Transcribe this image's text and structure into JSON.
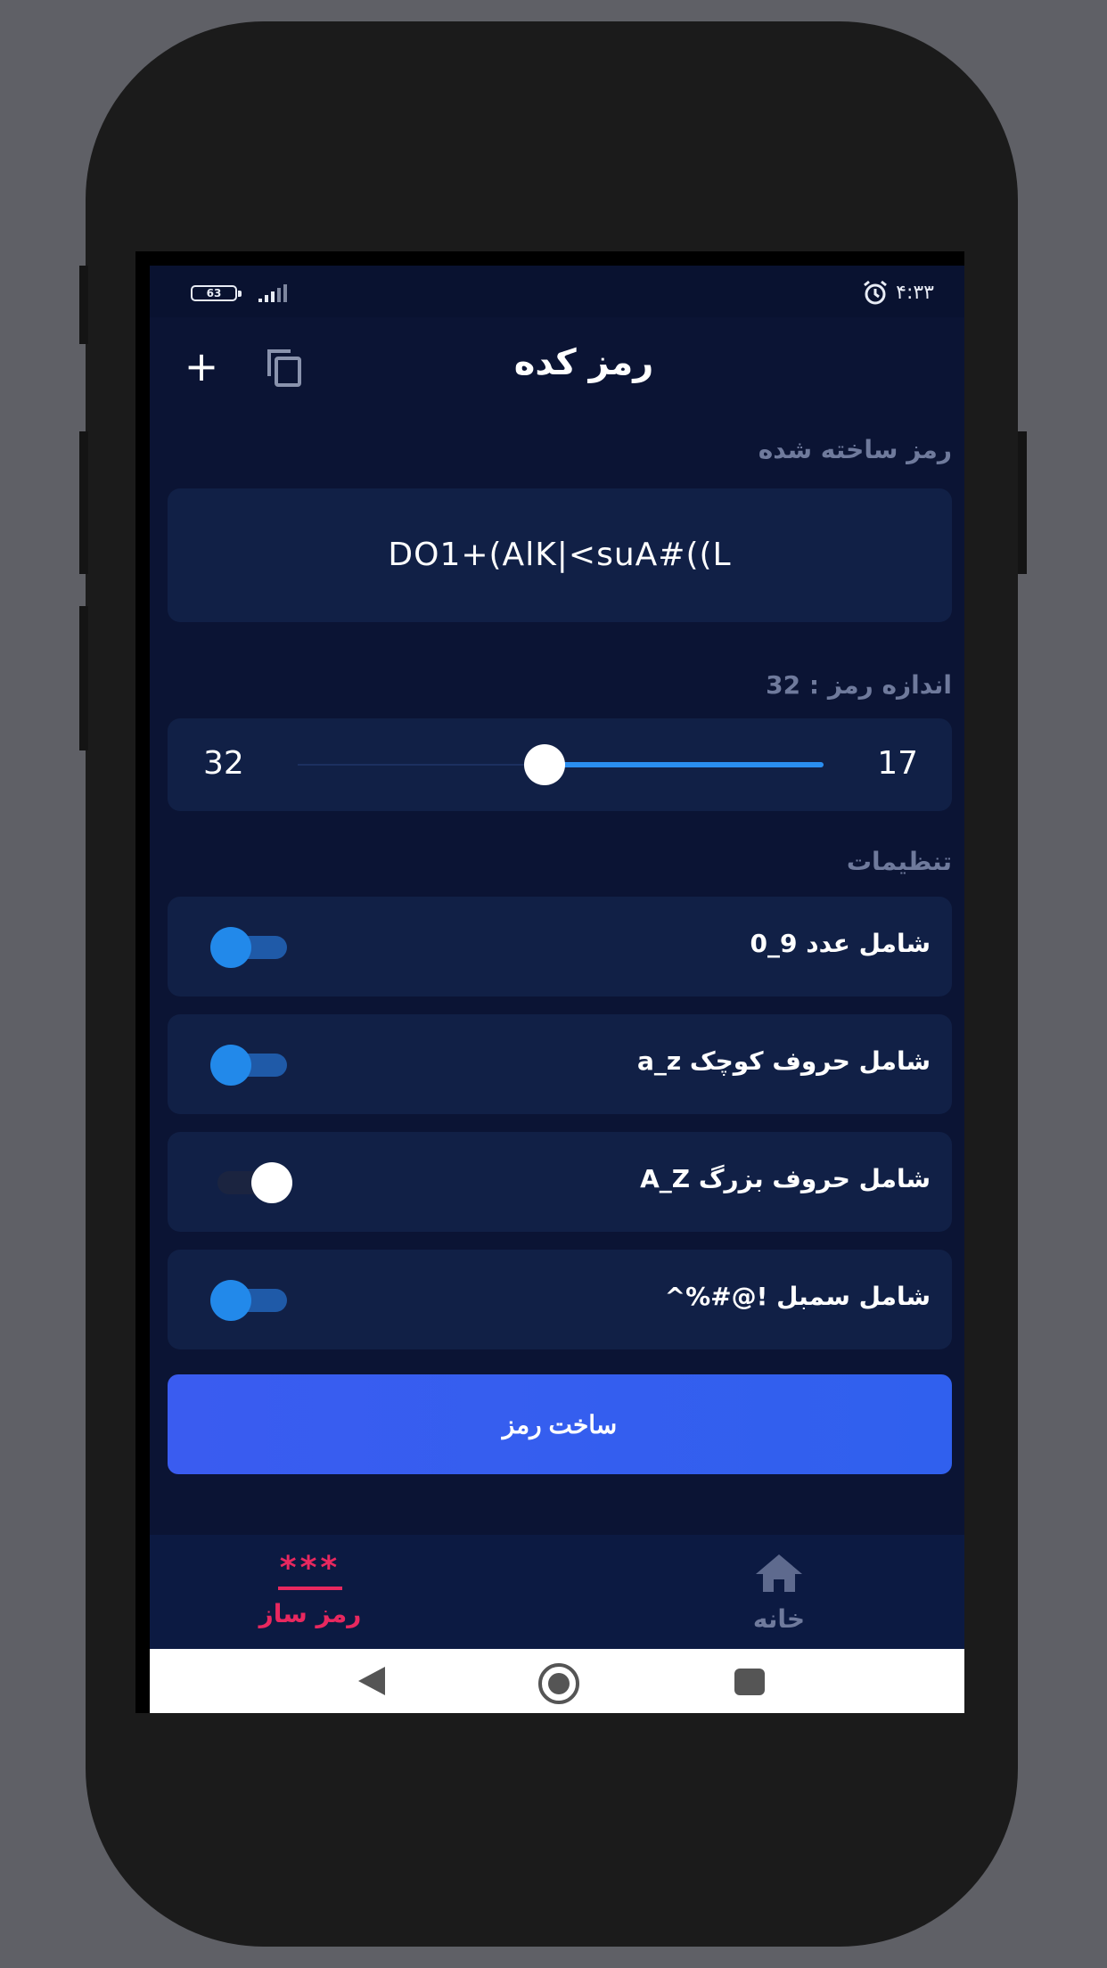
{
  "status_bar": {
    "battery": "63",
    "time": "۴:۳۳"
  },
  "app_bar": {
    "title": "رمز کده",
    "add_icon": "plus-icon",
    "copy_icon": "copy-icon"
  },
  "generated": {
    "label": "رمز ساخته شده",
    "password": "DO1+(AlK|<suA#((L"
  },
  "length": {
    "label": "اندازه رمز : 32",
    "min_label": "32",
    "max_label": "17",
    "value_fraction": 0.47
  },
  "settings": {
    "label": "تنظیمات",
    "options": [
      {
        "label": "شامل عدد  9_0",
        "on": true
      },
      {
        "label": "شامل حروف کوچک  a_z",
        "on": true
      },
      {
        "label": "شامل حروف بزرگ  A_Z",
        "on": false
      },
      {
        "label": "شامل سمبل  !@#%^",
        "on": true
      }
    ]
  },
  "generate_button": {
    "label": "ساخت رمز"
  },
  "bottom_nav": {
    "generator": {
      "icon_text": "***",
      "label": "رمز ساز",
      "active": true
    },
    "home": {
      "icon": "home-icon",
      "label": "خانه",
      "active": false
    }
  },
  "colors": {
    "background": "#0b1434",
    "card": "#112046",
    "accent_blue": "#2a8ef0",
    "accent_pink": "#e8285f",
    "button": "#3a5cf0"
  }
}
